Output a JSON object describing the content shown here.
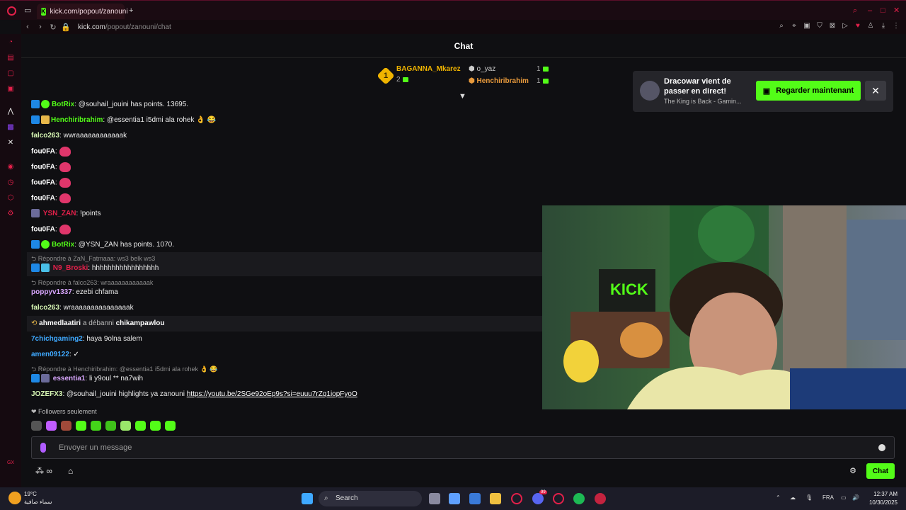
{
  "browser": {
    "tab_title": "kick.com/popout/zanouni",
    "new_tab": "+",
    "url_host": "kick.com",
    "url_path": "/popout/zanouni/chat"
  },
  "chat": {
    "title": "Chat",
    "leaderboard": {
      "first": {
        "rank": "1",
        "name": "BAGANNA_Mkarez",
        "count": "2"
      },
      "second": {
        "name": "o_yaz",
        "count": "1"
      },
      "third": {
        "name": "Henchiribrahim",
        "count": "1"
      }
    },
    "messages": [
      {
        "user": "BotRix",
        "text": "@souhail_jouini has points. 13695."
      },
      {
        "user": "Henchiribrahim",
        "text": "@essentia1 i5dmi ala rohek 👌 😂"
      },
      {
        "user": "falco263",
        "text": "wwraaaaaaaaaaaak"
      },
      {
        "user": "fou0FA",
        "text": ""
      },
      {
        "user": "fou0FA",
        "text": ""
      },
      {
        "user": "fou0FA",
        "text": ""
      },
      {
        "user": "fou0FA",
        "text": ""
      },
      {
        "user": "YSN_ZAN",
        "text": "!points"
      },
      {
        "user": "fou0FA",
        "text": ""
      },
      {
        "user": "BotRix",
        "text": "@YSN_ZAN has points. 1070."
      },
      {
        "reply": "Répondre à ZaN_Fatmaaa: ws3 belk ws3",
        "user": "N9_Broski",
        "text": "hhhhhhhhhhhhhhhhh"
      },
      {
        "reply": "Répondre à falco263: wraaaaaaaaaaaak",
        "user": "poppyv1337",
        "text": "ezebi chfama"
      },
      {
        "user": "falco263",
        "text": "wraaaaaaaaaaaaaaak"
      },
      {
        "user": "ahmedlaatiri",
        "action": "a débanni",
        "target": "chikampawlou"
      },
      {
        "user": "7chichgaming2",
        "text": "haya 9olna salem"
      },
      {
        "user": "amen09122",
        "text": ""
      },
      {
        "reply": "Répondre à Henchiribrahim: @essentia1 i5dmi ala rohek 👌 😂",
        "user": "essentia1",
        "text": "li y9oul ** na7wih"
      },
      {
        "user": "JOZEFX3",
        "text": "@souhail_jouini highlights ya zanouni ",
        "link": "https://youtu.be/2SGe92oEp9s?si=euuu7rZq1iopFyoO"
      }
    ],
    "followers_only": "Followers seulement",
    "input_placeholder": "Envoyer un message",
    "chat_button": "Chat"
  },
  "notification": {
    "title": "Dracowar vient de passer en direct!",
    "subtitle": "The King is Back - Gamin...",
    "button": "Regarder maintenant",
    "close": "✕"
  },
  "video": {
    "overlay_text": "KICK"
  },
  "taskbar": {
    "temperature": "19°C",
    "weather_text": "سماء صافية",
    "search": "Search",
    "lang": "FRA",
    "time": "12:37 AM",
    "date": "10/30/2025",
    "notification_count": "99"
  },
  "colors": {
    "kick_green": "#53fc18",
    "opera_red": "#e4204a"
  }
}
